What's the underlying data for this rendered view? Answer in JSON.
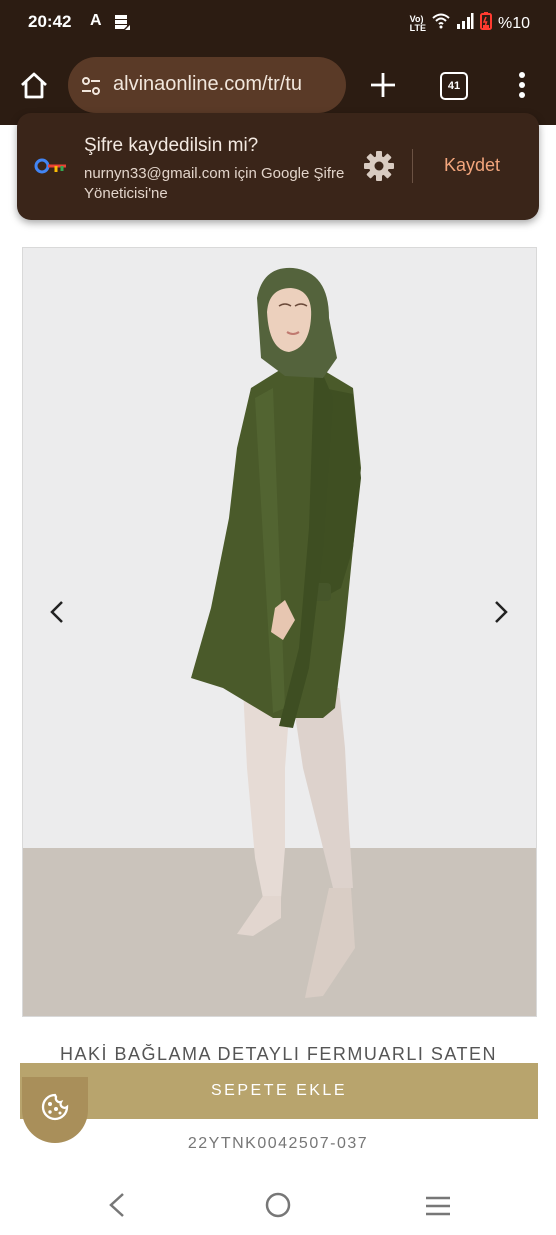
{
  "status_bar": {
    "time": "20:42",
    "notification": "A",
    "network": "LTE",
    "battery": "%10"
  },
  "browser": {
    "url": "alvinaonline.com/tr/tu",
    "tab_count": "41"
  },
  "password_prompt": {
    "title": "Şifre kaydedilsin mi?",
    "description": "nurnyn33@gmail.com için Google Şifre Yöneticisi'ne",
    "save_label": "Kaydet"
  },
  "product": {
    "title": "HAKİ BAĞLAMA DETAYLI FERMUARLI SATEN",
    "add_to_cart_label": "SEPETE EKLE",
    "sku": "22YTNK0042507-037"
  },
  "colors": {
    "browser_bar": "#2c1c12",
    "url_box": "#5a3a27",
    "save_accent": "#f2a57c",
    "cart_button": "#b8a46d",
    "tunic": "#4a5a2a"
  }
}
